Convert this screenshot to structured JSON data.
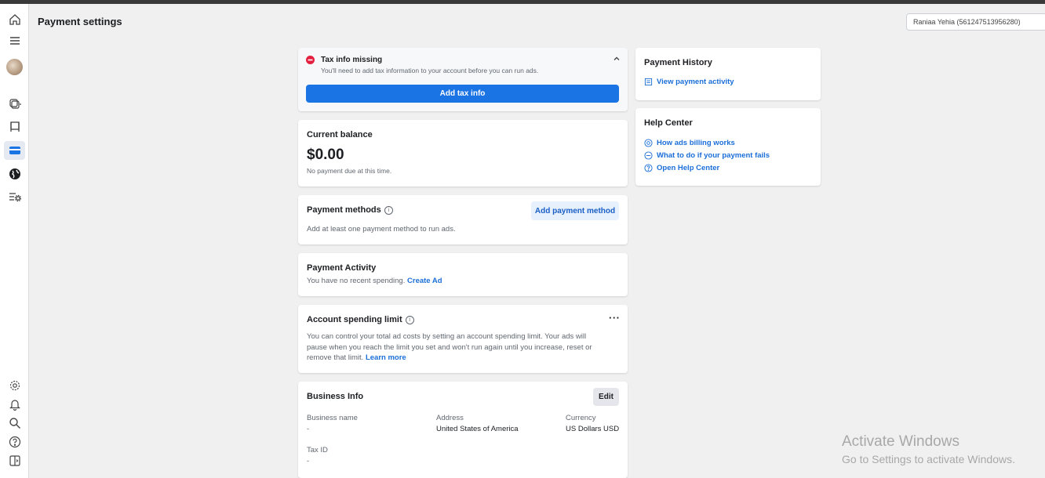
{
  "header": {
    "title": "Payment settings",
    "account_selector": "Raniaa Yehia (561247513956280)"
  },
  "sidebar": {
    "icons": [
      "home-icon",
      "menu-icon",
      "avatar",
      "campaigns-icon",
      "flag-icon",
      "credit-card-icon",
      "globe-icon",
      "settings-list-icon",
      "gear-icon",
      "bell-icon",
      "search-icon",
      "help-icon",
      "collapse-icon"
    ]
  },
  "tax_alert": {
    "title": "Tax info missing",
    "message": "You'll need to add tax information to your account before you can run ads.",
    "button": "Add tax info"
  },
  "balance": {
    "title": "Current balance",
    "amount": "$0.00",
    "note": "No payment due at this time."
  },
  "payment_methods": {
    "title": "Payment methods",
    "button": "Add payment method",
    "message": "Add at least one payment method to run ads."
  },
  "payment_activity": {
    "title": "Payment Activity",
    "message": "You have no recent spending.",
    "link": "Create Ad"
  },
  "spending_limit": {
    "title": "Account spending limit",
    "line1": "You can control your total ad costs by setting an account spending limit. Your ads will",
    "line2": "pause when you reach the limit you set and won't run again until you increase, reset or",
    "line3": "remove that limit.",
    "link": "Learn more"
  },
  "business_info": {
    "title": "Business Info",
    "edit": "Edit",
    "business_name_label": "Business name",
    "business_name_value": "-",
    "address_label": "Address",
    "address_value": "United States of America",
    "currency_label": "Currency",
    "currency_value": "US Dollars USD",
    "tax_id_label": "Tax ID",
    "tax_id_value": "-"
  },
  "payment_history": {
    "title": "Payment History",
    "link": "View payment activity"
  },
  "help_center": {
    "title": "Help Center",
    "links": [
      "How ads billing works",
      "What to do if your payment fails",
      "Open Help Center"
    ]
  },
  "watermark": {
    "line1": "Activate Windows",
    "line2": "Go to Settings to activate Windows."
  },
  "colors": {
    "accent": "#1b74e4",
    "link": "#1a6ed8",
    "error": "#e41e3f",
    "background": "#f0f0f0"
  }
}
